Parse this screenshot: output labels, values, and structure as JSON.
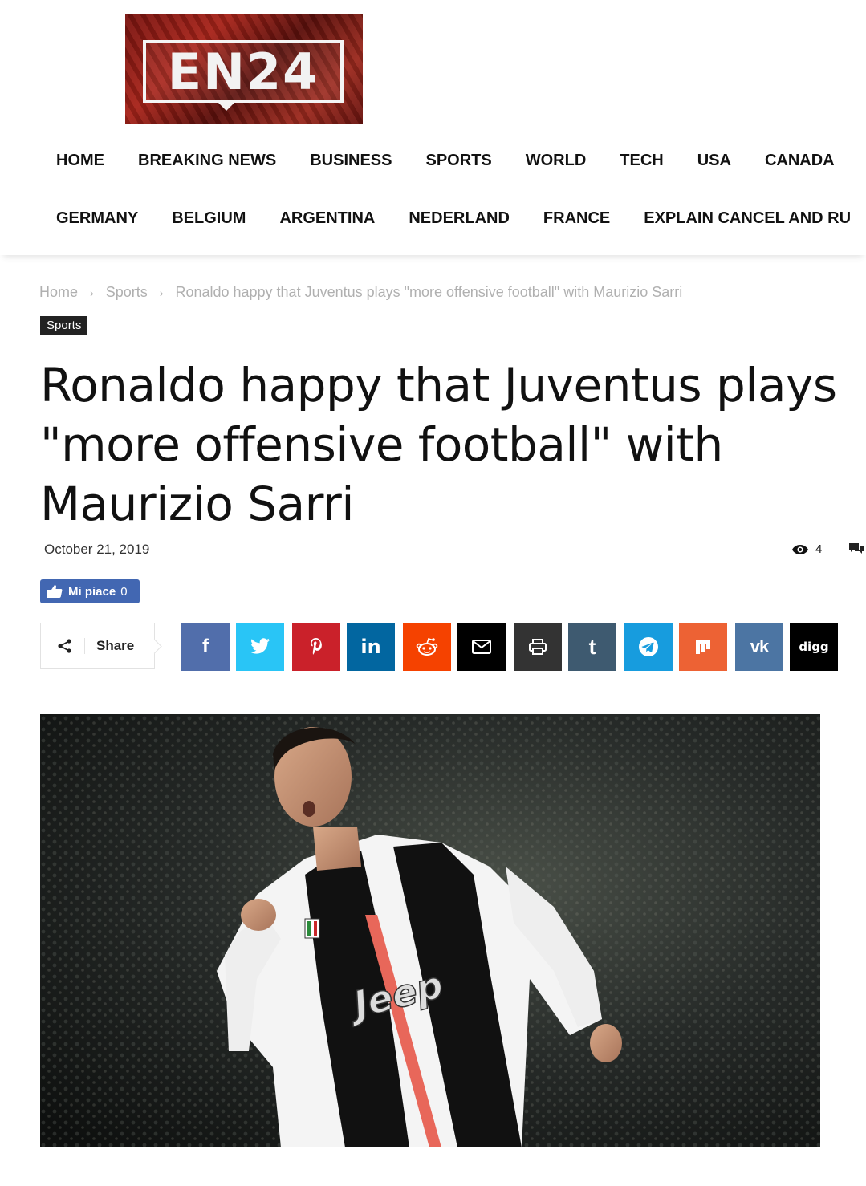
{
  "site": {
    "logo_text": "EN24"
  },
  "nav": {
    "row1": [
      "HOME",
      "BREAKING NEWS",
      "BUSINESS",
      "SPORTS",
      "WORLD",
      "TECH",
      "USA",
      "CANADA"
    ],
    "row2": [
      "GERMANY",
      "BELGIUM",
      "ARGENTINA",
      "NEDERLAND",
      "FRANCE",
      "EXPLAIN CANCEL AND RU"
    ]
  },
  "breadcrumb": {
    "home": "Home",
    "section": "Sports",
    "current": "Ronaldo happy that Juventus plays \"more offensive football\" with Maurizio Sarri",
    "separator": "›"
  },
  "article": {
    "category": "Sports",
    "title": "Ronaldo happy that Juventus plays \"more offensive football\" with Maurizio Sarri",
    "date": "October 21, 2019",
    "views": "4"
  },
  "facebook": {
    "like_label": "Mi piace",
    "like_count": "0"
  },
  "share": {
    "label": "Share",
    "networks": [
      {
        "name": "facebook",
        "glyph": "f",
        "color": "#516eab"
      },
      {
        "name": "twitter",
        "glyph": "",
        "color": "#29c5f6"
      },
      {
        "name": "pinterest",
        "glyph": "P",
        "color": "#ca212a"
      },
      {
        "name": "linkedin",
        "glyph": "in",
        "color": "#0266a0"
      },
      {
        "name": "reddit",
        "glyph": "",
        "color": "#f54200"
      },
      {
        "name": "email",
        "glyph": "",
        "color": "#000000"
      },
      {
        "name": "print",
        "glyph": "",
        "color": "#333333"
      },
      {
        "name": "tumblr",
        "glyph": "t",
        "color": "#3e5a70"
      },
      {
        "name": "telegram",
        "glyph": "",
        "color": "#179cde"
      },
      {
        "name": "mix",
        "glyph": "m",
        "color": "#ed6234"
      },
      {
        "name": "vk",
        "glyph": "vk",
        "color": "#4c75a3"
      },
      {
        "name": "digg",
        "glyph": "digg",
        "color": "#000000"
      }
    ]
  },
  "hero_image": {
    "jersey_sponsor": "Jeep"
  }
}
